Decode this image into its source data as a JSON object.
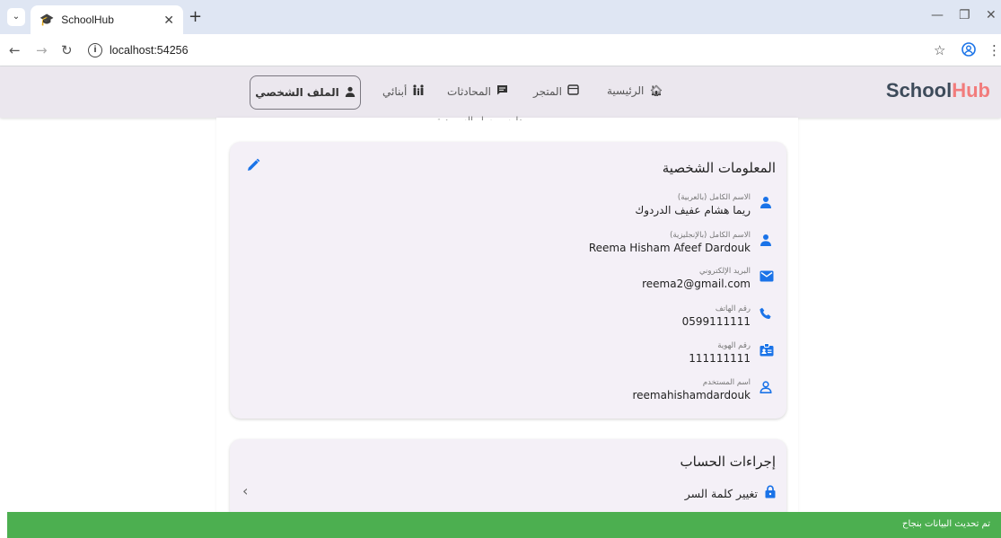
{
  "browser": {
    "tab_title": "SchoolHub",
    "url": "localhost:54256",
    "icons": [
      "tab-search-icon",
      "favicon-icon",
      "tab-close-icon",
      "new-tab-icon",
      "back-icon",
      "forward-icon",
      "reload-icon",
      "site-info-icon",
      "bookmark-star-icon",
      "profile-icon",
      "menu-icon",
      "minimize-icon",
      "restore-icon",
      "close-window-icon"
    ]
  },
  "brand": {
    "school": "School",
    "hub": "Hub"
  },
  "nav": {
    "home": "الرئيسية",
    "store": "المتجر",
    "chats": "المحادثات",
    "children": "أبنائي",
    "profile": "الملف الشخصي"
  },
  "page": {
    "cutoff_text": "مدارس يسار السعودية"
  },
  "personal_info": {
    "title": "المعلومات الشخصية",
    "fields": [
      {
        "label": "الاسم الكامل (بالعربية)",
        "value": "ريما هشام عفيف الدردوك",
        "icon": "person-icon"
      },
      {
        "label": "الاسم الكامل (بالإنجليزية)",
        "value": "Reema Hisham Afeef Dardouk",
        "icon": "person-icon"
      },
      {
        "label": "البريد الإلكتروني",
        "value": "reema2@gmail.com",
        "icon": "email-icon"
      },
      {
        "label": "رقم الهاتف",
        "value": "0599111111",
        "icon": "phone-icon"
      },
      {
        "label": "رقم الهوية",
        "value": "111111111",
        "icon": "id-badge-icon"
      },
      {
        "label": "اسم المستخدم",
        "value": "reemahishamdardouk",
        "icon": "user-outline-icon"
      }
    ]
  },
  "account_actions": {
    "title": "إجراءات الحساب",
    "change_password": "تغيير كلمة السر"
  },
  "snackbar": {
    "message": "تم تحديث البيانات بنجاح"
  },
  "colors": {
    "brand_dark": "#3d4b5a",
    "brand_accent": "#f27c7c",
    "icon_blue": "#1a73e8",
    "snackbar": "#4caf50"
  }
}
